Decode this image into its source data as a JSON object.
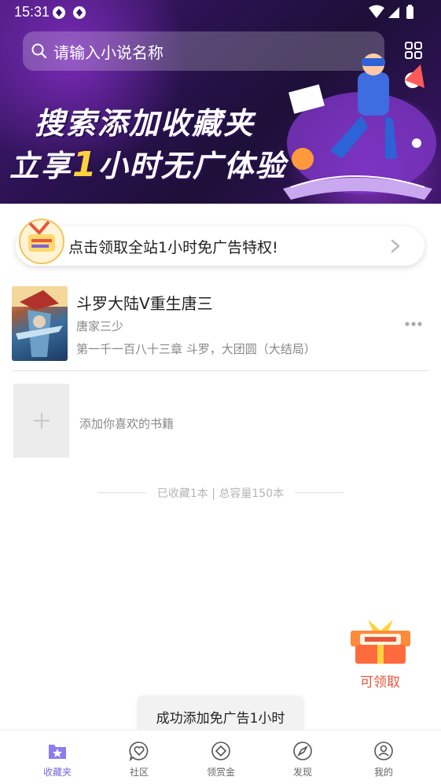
{
  "status": {
    "time": "15:31"
  },
  "search": {
    "placeholder": "请输入小说名称"
  },
  "banner": {
    "line1": "搜索添加收藏夹",
    "line2_pre": "立享",
    "line2_big": "1",
    "line2_post": "小时无广体验"
  },
  "privilege": {
    "text": "点击领取全站1小时免广告特权!"
  },
  "book": {
    "title": "斗罗大陆V重生唐三",
    "author": "唐家三少",
    "latest_chapter": "第一千一百八十三章 斗罗，大团圆（大结局）"
  },
  "add_book": {
    "text": "添加你喜欢的书籍"
  },
  "summary": {
    "text": "已收藏1本 | 总容量150本"
  },
  "reward": {
    "label": "可领取"
  },
  "toast": {
    "text": "成功添加免广告1小时"
  },
  "tabs": [
    {
      "label": "收藏夹",
      "icon": "bookshelf-icon",
      "active": true
    },
    {
      "label": "社区",
      "icon": "heart-chat-icon",
      "active": false
    },
    {
      "label": "领赏金",
      "icon": "coin-icon",
      "active": false
    },
    {
      "label": "发现",
      "icon": "compass-icon",
      "active": false
    },
    {
      "label": "我的",
      "icon": "profile-icon",
      "active": false
    }
  ],
  "colors": {
    "accent": "#7a64d8",
    "reward": "#e8553b",
    "banner_highlight": "#ffd23c"
  }
}
